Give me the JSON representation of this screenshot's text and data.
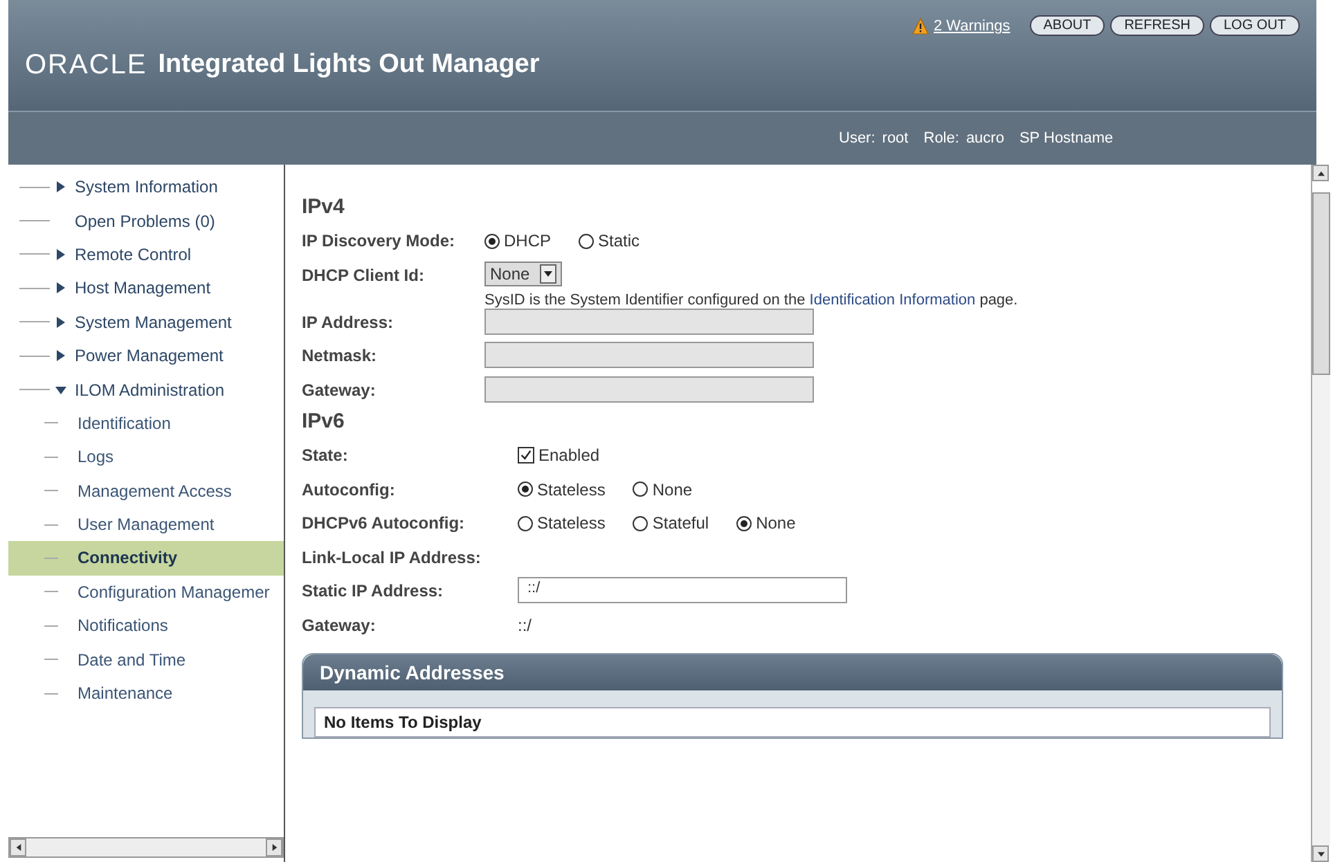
{
  "header": {
    "logo": "ORACLE",
    "title": "Integrated Lights Out Manager",
    "warnings": "2 Warnings",
    "buttons": [
      "ABOUT",
      "REFRESH",
      "LOG OUT"
    ]
  },
  "user_bar": {
    "user_label": "User:",
    "user": "root",
    "role_label": "Role:",
    "role": "aucro",
    "hostname_label": "SP Hostname"
  },
  "sidebar": {
    "items": [
      {
        "label": "System Information",
        "kind": "group",
        "expanded": false,
        "selected": false
      },
      {
        "label": "Open Problems (0)",
        "kind": "leaf",
        "selected": false
      },
      {
        "label": "Remote Control",
        "kind": "group",
        "expanded": false,
        "selected": false
      },
      {
        "label": "Host Management",
        "kind": "group",
        "expanded": false,
        "selected": false
      },
      {
        "label": "System Management",
        "kind": "group",
        "expanded": false,
        "selected": false
      },
      {
        "label": "Power Management",
        "kind": "group",
        "expanded": false,
        "selected": false
      },
      {
        "label": "ILOM Administration",
        "kind": "group",
        "expanded": true,
        "selected": false,
        "children": [
          {
            "label": "Identification",
            "selected": false
          },
          {
            "label": "Logs",
            "selected": false
          },
          {
            "label": "Management Access",
            "selected": false
          },
          {
            "label": "User Management",
            "selected": false
          },
          {
            "label": "Connectivity",
            "selected": true
          },
          {
            "label": "Configuration Managemer",
            "selected": false
          },
          {
            "label": "Notifications",
            "selected": false
          },
          {
            "label": "Date and Time",
            "selected": false
          },
          {
            "label": "Maintenance",
            "selected": false
          }
        ]
      }
    ]
  },
  "sections": [
    {
      "title": "IPv4",
      "rows": [
        {
          "label": "IP Discovery Mode:",
          "kind": "radio",
          "options": [
            {
              "label": "DHCP",
              "selected": true
            },
            {
              "label": "Static",
              "selected": false
            }
          ]
        },
        {
          "label": "DHCP Client Id:",
          "kind": "select",
          "value": "None",
          "note": "SysID is the System Identifier configured on the ",
          "link": "Identification Information",
          "note_end": " page."
        },
        {
          "label": "IP Address:",
          "kind": "field",
          "disabled": true
        },
        {
          "label": "Netmask:",
          "kind": "field",
          "disabled": true
        },
        {
          "label": "Gateway:",
          "kind": "field",
          "disabled": true
        }
      ]
    },
    {
      "title": "IPv6",
      "rows": [
        {
          "label": "State:",
          "kind": "checkbox",
          "checked": true,
          "text": "Enabled"
        },
        {
          "label": "Autoconfig:",
          "kind": "radio",
          "options": [
            {
              "label": "Stateless",
              "selected": true
            },
            {
              "label": "None",
              "selected": false
            }
          ]
        },
        {
          "label": "DHCPv6 Autoconfig:",
          "kind": "radio",
          "options": [
            {
              "label": "Stateless",
              "selected": false
            },
            {
              "label": "Stateful",
              "selected": false
            },
            {
              "label": "None",
              "selected": true
            }
          ]
        },
        {
          "label": "Link-Local IP Address:",
          "kind": "text"
        },
        {
          "label": "Static IP Address:",
          "kind": "field",
          "disabled": false,
          "value": "::/"
        },
        {
          "label": "Gateway:",
          "kind": "text",
          "value": "::/"
        }
      ]
    }
  ],
  "dynamic_addresses": {
    "title": "Dynamic Addresses",
    "empty_text": "No Items To Display"
  }
}
